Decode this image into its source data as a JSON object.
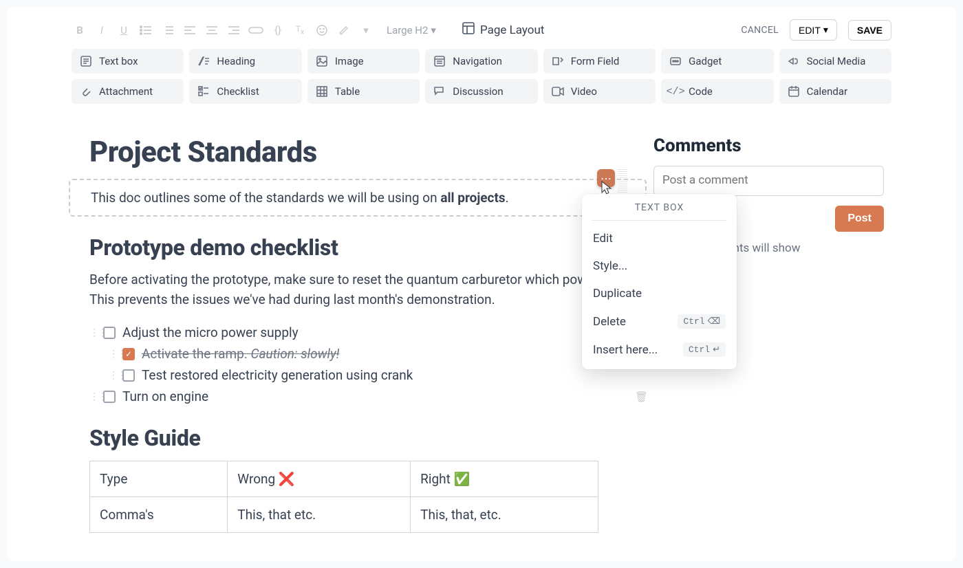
{
  "toolbar": {
    "style_dropdown": "Large H2",
    "page_layout": "Page Layout",
    "cancel": "CANCEL",
    "edit": "EDIT",
    "save": "SAVE"
  },
  "insert_items": [
    {
      "icon": "text",
      "label": "Text box"
    },
    {
      "icon": "heading",
      "label": "Heading"
    },
    {
      "icon": "image",
      "label": "Image"
    },
    {
      "icon": "nav",
      "label": "Navigation"
    },
    {
      "icon": "form",
      "label": "Form Field"
    },
    {
      "icon": "gadget",
      "label": "Gadget"
    },
    {
      "icon": "social",
      "label": "Social Media"
    },
    {
      "icon": "attach",
      "label": "Attachment"
    },
    {
      "icon": "checklist",
      "label": "Checklist"
    },
    {
      "icon": "table",
      "label": "Table"
    },
    {
      "icon": "discussion",
      "label": "Discussion"
    },
    {
      "icon": "video",
      "label": "Video"
    },
    {
      "icon": "code",
      "label": "Code"
    },
    {
      "icon": "calendar",
      "label": "Calendar"
    }
  ],
  "doc": {
    "title": "Project Standards",
    "intro_prefix": "This doc outlines some of the standards we will be using on ",
    "intro_bold": "all projects",
    "intro_suffix": ".",
    "section_checklist": "Prototype demo checklist",
    "checklist_para": "Before activating the prototype, make sure to reset the quantum carburetor which powe\nThis prevents the issues we've had during last month's demonstration.",
    "checklist": [
      {
        "indent": 0,
        "checked": false,
        "text": "Adjust the micro power supply"
      },
      {
        "indent": 1,
        "checked": true,
        "text": "Activate the ramp. ",
        "caution": "Caution: slowly!"
      },
      {
        "indent": 1,
        "checked": false,
        "text": "Test restored electricity generation using crank"
      },
      {
        "indent": 0,
        "checked": false,
        "text": "Turn on engine",
        "trash": true
      }
    ],
    "section_style": "Style Guide",
    "table": {
      "headers": [
        "Type",
        "Wrong ❌",
        "Right ✅"
      ],
      "rows": [
        [
          "Comma's",
          "This, that etc.",
          "This, that, etc."
        ]
      ]
    }
  },
  "comments": {
    "title": "Comments",
    "placeholder": "Post a comment",
    "post": "Post",
    "hint_suffix": "e page, comments will show"
  },
  "context_menu": {
    "title": "TEXT BOX",
    "items": [
      {
        "label": "Edit"
      },
      {
        "label": "Style..."
      },
      {
        "label": "Duplicate"
      },
      {
        "label": "Delete",
        "kbd": "Ctrl",
        "kbdglyph": "⌫"
      },
      {
        "label": "Insert here...",
        "kbd": "Ctrl",
        "kbdglyph": "↵"
      }
    ]
  }
}
